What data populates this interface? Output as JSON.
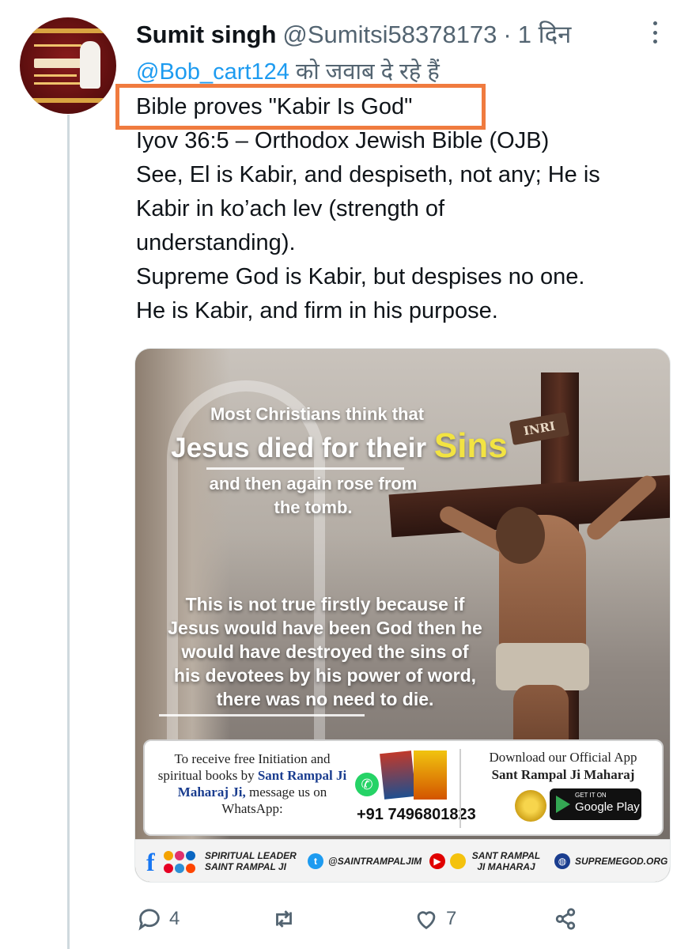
{
  "tweet": {
    "author_name": "Sumit singh",
    "handle": "@Sumitsi58378173",
    "separator": "·",
    "time": "1 दिन",
    "reply_to_mention": "@Bob_cart124",
    "reply_to_suffix": "को जवाब दे रहे हैं",
    "text_lines": [
      "Bible proves \"Kabir Is God\"",
      "Iyov 36:5 – Orthodox Jewish Bible (OJB)",
      "See, El is Kabir, and despiseth, not any; He is",
      "Kabir in ko’ach lev (strength of",
      "understanding).",
      "Supreme God is Kabir, but despises no one.",
      "He is Kabir, and firm in his purpose."
    ],
    "highlight_color": "#f07b3f"
  },
  "media": {
    "inri": "INRI",
    "headline_small": "Most Christians think that",
    "headline_main": "Jesus died for their",
    "headline_accent": "Sins",
    "headline_accent_color": "#f2e342",
    "subline": "and then again rose from the tomb.",
    "body": "This is not true firstly because if Jesus would have been God then he would have destroyed the sins of his devotees by his power of word, there was no need to die.",
    "promo": {
      "left_line1": "To receive free Initiation and spiritual books by",
      "left_bold": "Sant Rampal Ji Maharaj Ji,",
      "left_line2": "message us on WhatsApp:",
      "phone": "+91 7496801823",
      "right_line1": "Download our Official App",
      "right_bold": "Sant Rampal Ji Maharaj",
      "store_small": "GET IT ON",
      "store_big": "Google Play"
    },
    "footer": {
      "social_label": "SPIRITUAL LEADER SAINT RAMPAL JI",
      "twitter": "@SAINTRAMPALJIM",
      "youtube": "SANT RAMPAL JI MAHARAJ",
      "website": "SUPREMEGOD.ORG"
    }
  },
  "actions": {
    "reply_count": "4",
    "retweet_count": "",
    "like_count": "7"
  },
  "icons": [
    "more-icon",
    "reply-icon",
    "retweet-icon",
    "like-icon",
    "share-icon",
    "whatsapp-icon",
    "google-play-icon",
    "twitter-icon",
    "youtube-icon",
    "globe-icon"
  ]
}
